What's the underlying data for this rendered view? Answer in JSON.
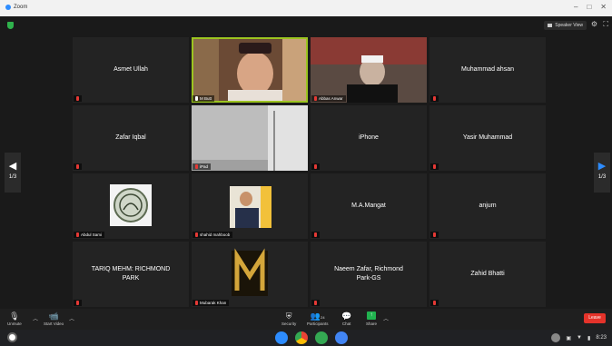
{
  "window": {
    "title": "Zoom",
    "controls": [
      "–",
      "□",
      "✕"
    ]
  },
  "header": {
    "view_label": "Speaker View"
  },
  "nav": {
    "left_page": "1/3",
    "right_page": "1/3"
  },
  "tiles": [
    {
      "name": "Asmet Ullah",
      "label": "",
      "type": "name"
    },
    {
      "name": "",
      "label": "M Butt",
      "type": "video"
    },
    {
      "name": "",
      "label": "Abbas Anwar",
      "type": "video"
    },
    {
      "name": "Muhammad ahsan",
      "label": "",
      "type": "name"
    },
    {
      "name": "Zafar Iqbal",
      "label": "",
      "type": "name"
    },
    {
      "name": "",
      "label": "iPad",
      "type": "video"
    },
    {
      "name": "iPhone",
      "label": "",
      "type": "name"
    },
    {
      "name": "Yasir Muhammad",
      "label": "",
      "type": "name"
    },
    {
      "name": "",
      "label": "Abdul Sami",
      "type": "image"
    },
    {
      "name": "",
      "label": "shahid mahboob",
      "type": "image"
    },
    {
      "name": "M.A.Mangat",
      "label": "",
      "type": "name"
    },
    {
      "name": "anjum",
      "label": "",
      "type": "name"
    },
    {
      "name": "TARIQ MEHM: RICHMOND PARK",
      "label": "",
      "type": "name"
    },
    {
      "name": "",
      "label": "Mubarak Khan",
      "type": "image"
    },
    {
      "name": "Naeem Zafar, Richmond Park-GS",
      "label": "",
      "type": "name"
    },
    {
      "name": "Zahid Bhatti",
      "label": "",
      "type": "name"
    }
  ],
  "toolbar": {
    "unmute_label": "Unmute",
    "start_video_label": "Start Video",
    "security_label": "Security",
    "participants_label": "Participants",
    "participants_count": "24",
    "chat_label": "Chat",
    "share_label": "Share",
    "leave_label": "Leave"
  },
  "taskbar": {
    "time": "8:23"
  },
  "colors": {
    "leave": "#e5332a",
    "active_speaker": "#9cc420",
    "share": "#21b24f"
  }
}
